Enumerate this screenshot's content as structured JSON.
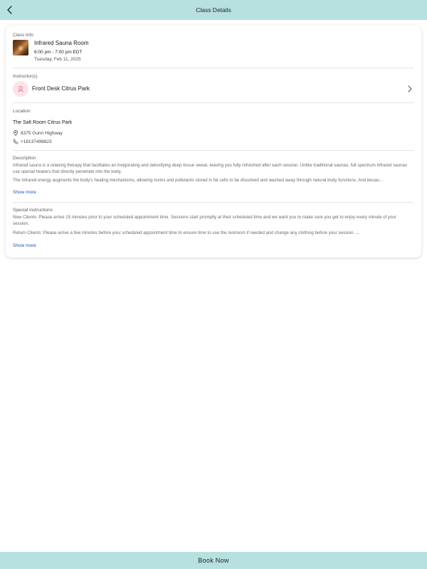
{
  "header": {
    "title": "Class Details",
    "back_icon": "chevron-left-icon"
  },
  "class_info": {
    "label": "Class Info",
    "name": "Infrared Sauna Room",
    "time": "6:00 pm - 7:00 pm EDT",
    "date": "Tuesday, Feb 11, 2025"
  },
  "instructors": {
    "label": "Instructor(s)",
    "name": "Front Desk Citrus Park",
    "avatar_icon": "person-icon",
    "avatar_color": "#fbe4e8",
    "avatar_icon_color": "#e06b82"
  },
  "location": {
    "label": "Location",
    "name": "The Salt Room Citrus Park",
    "address": "8375 Gunn Highway",
    "phone": "+18137496823"
  },
  "description": {
    "label": "Description",
    "para1": "Infrared sauna is a relaxing therapy that facilitates an invigorating and detoxifying deep tissue sweat, leaving you fully refreshed after each session. Unlike traditional saunas, full spectrum infrared saunas use special heaters that directly penetrate into the body.",
    "para2": "The infrared energy augments the body's healing mechanisms, allowing toxins and pollutants stored in fat cells to be dissolved and washed away through natural body functions. And becau...",
    "show_more": "Show more"
  },
  "special_instructions": {
    "label": "Special instructions",
    "para1": "New Clients: Please arrive 15 minutes prior to your scheduled appointment time. Sessions start promptly at their scheduled time and we want you to make sure you get to enjoy every minute of your session.",
    "para2": "Return Clients: Please arrive a few minutes before your scheduled appointment time to ensure time to use the restroom if needed and change any clothing before your session. ...",
    "show_more": "Show more"
  },
  "footer": {
    "book_label": "Book Now"
  },
  "colors": {
    "header_bg": "#b7e0e0",
    "footer_bg": "#b7e0e0",
    "link": "#1a52c4"
  }
}
